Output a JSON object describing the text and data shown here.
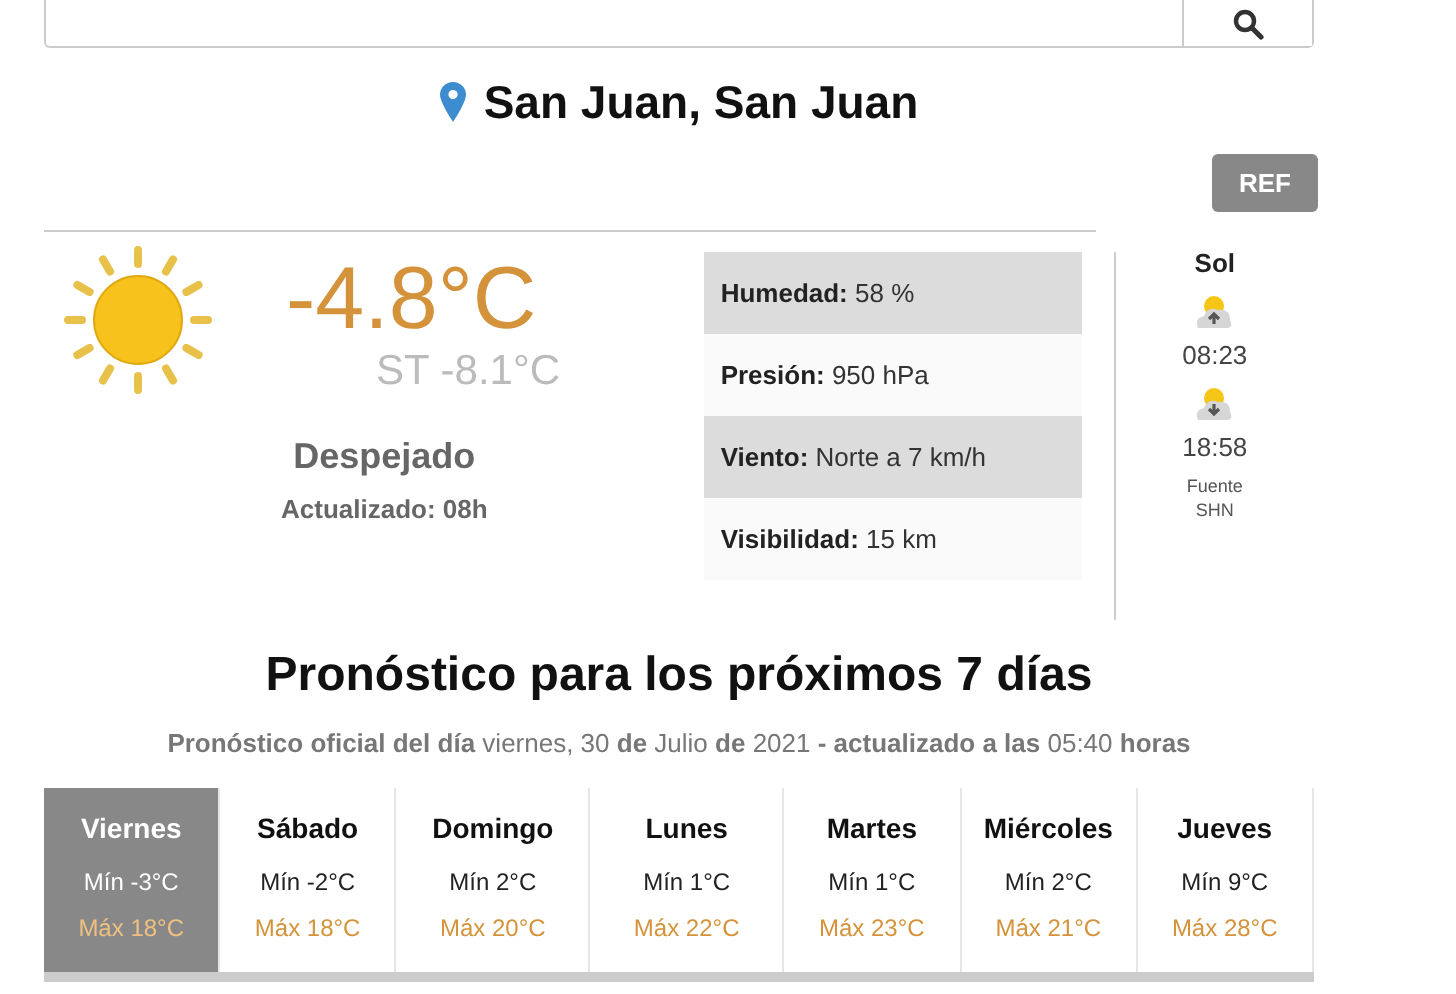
{
  "location": {
    "title": "San Juan, San Juan"
  },
  "ref_button": {
    "label": "REF"
  },
  "current": {
    "temperature": "-4.8°C",
    "feels_like": "ST -8.1°C",
    "description": "Despejado",
    "updated": "Actualizado: 08h"
  },
  "details": [
    {
      "label": "Humedad:",
      "value": "58 %",
      "shaded": true
    },
    {
      "label": "Presión:",
      "value": "950 hPa",
      "shaded": false
    },
    {
      "label": "Viento:",
      "value": "Norte a 7 km/h",
      "shaded": true
    },
    {
      "label": "Visibilidad:",
      "value": "15 km",
      "shaded": false
    }
  ],
  "sun": {
    "title": "Sol",
    "sunrise": "08:23",
    "sunset": "18:58",
    "source": [
      "Fuente",
      "SHN"
    ]
  },
  "forecast": {
    "title": "Pronóstico para los próximos 7 días",
    "subtitle": "**Pronóstico oficial del día** viernes, 30 **de** Julio **de** 2021 **- actualizado a las** 05:40 **horas**",
    "days": [
      {
        "day": "Viernes",
        "min": "Mín -3°C",
        "max": "Máx 18°C",
        "selected": true
      },
      {
        "day": "Sábado",
        "min": "Mín -2°C",
        "max": "Máx 18°C",
        "selected": false
      },
      {
        "day": "Domingo",
        "min": "Mín 2°C",
        "max": "Máx 20°C",
        "selected": false
      },
      {
        "day": "Lunes",
        "min": "Mín 1°C",
        "max": "Máx 22°C",
        "selected": false
      },
      {
        "day": "Martes",
        "min": "Mín 1°C",
        "max": "Máx 23°C",
        "selected": false
      },
      {
        "day": "Miércoles",
        "min": "Mín 2°C",
        "max": "Máx 21°C",
        "selected": false
      },
      {
        "day": "Jueves",
        "min": "Mín 9°C",
        "max": "Máx 28°C",
        "selected": false
      }
    ]
  }
}
